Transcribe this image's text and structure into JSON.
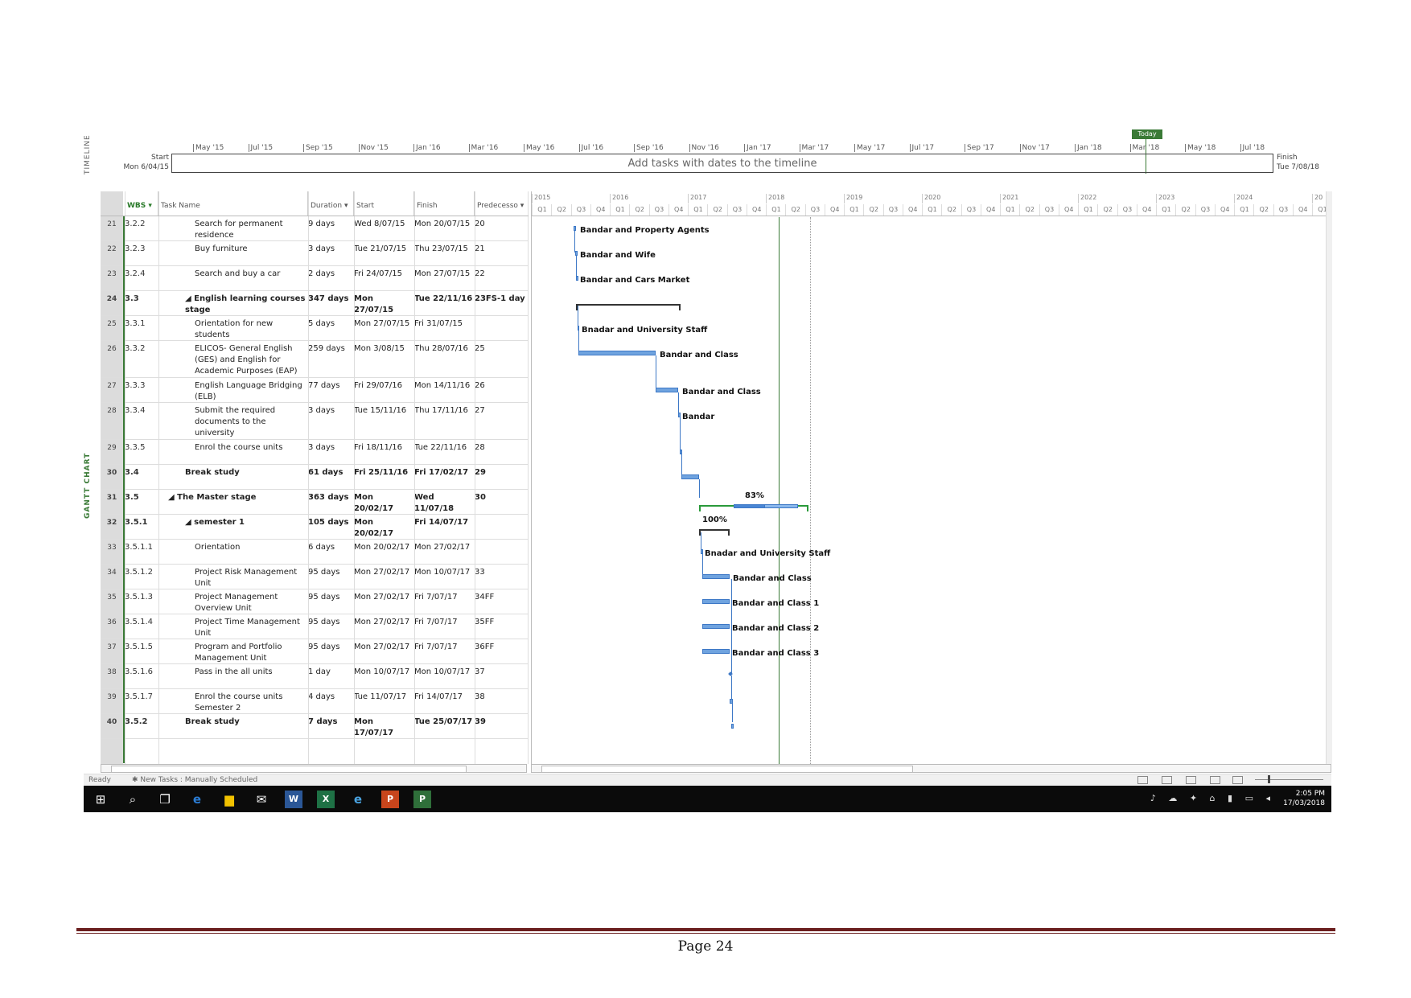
{
  "timeline": {
    "label": "TIMELINE",
    "months": [
      "May '15",
      "Jul '15",
      "Sep '15",
      "Nov '15",
      "Jan '16",
      "Mar '16",
      "May '16",
      "Jul '16",
      "Sep '16",
      "Nov '16",
      "Jan '17",
      "Mar '17",
      "May '17",
      "Jul '17",
      "Sep '17",
      "Nov '17",
      "Jan '18",
      "Mar '18",
      "May '18",
      "Jul '18"
    ],
    "start_label": "Start",
    "start_date": "Mon 6/04/15",
    "finish_label": "Finish",
    "finish_date": "Tue 7/08/18",
    "placeholder": "Add tasks with dates to the timeline",
    "today": "Today"
  },
  "gantt_label": "GANTT CHART",
  "columns": {
    "wbs": "WBS ▾",
    "task_name": "Task Name",
    "duration": "Duration ▾",
    "start": "Start",
    "finish": "Finish",
    "predecessors": "Predecesso ▾"
  },
  "years": [
    "2015",
    "2016",
    "2017",
    "2018",
    "2019",
    "2020",
    "2021",
    "2022",
    "2023",
    "2024",
    "20"
  ],
  "quarters": [
    "Q1",
    "Q2",
    "Q3",
    "Q4"
  ],
  "tasks": [
    {
      "id": "21",
      "wbs": "3.2.2",
      "name": "Search for permanent residence",
      "duration": "9 days",
      "start": "Wed 8/07/15",
      "finish": "Mon 20/07/15",
      "pred": "20",
      "bold": false,
      "indent": 3,
      "lines": 2
    },
    {
      "id": "22",
      "wbs": "3.2.3",
      "name": "Buy furniture",
      "duration": "3 days",
      "start": "Tue 21/07/15",
      "finish": "Thu 23/07/15",
      "pred": "21",
      "bold": false,
      "indent": 3,
      "lines": 2
    },
    {
      "id": "23",
      "wbs": "3.2.4",
      "name": "Search and buy a car",
      "duration": "2 days",
      "start": "Fri 24/07/15",
      "finish": "Mon 27/07/15",
      "pred": "22",
      "bold": false,
      "indent": 3,
      "lines": 2
    },
    {
      "id": "24",
      "wbs": "3.3",
      "name": "◢ English learning courses stage",
      "duration": "347 days",
      "start": "Mon 27/07/15",
      "finish": "Tue 22/11/16",
      "pred": "23FS-1 day",
      "bold": true,
      "indent": 2,
      "lines": 2
    },
    {
      "id": "25",
      "wbs": "3.3.1",
      "name": "Orientation for new students",
      "duration": "5 days",
      "start": "Mon 27/07/15",
      "finish": "Fri 31/07/15",
      "pred": "",
      "bold": false,
      "indent": 3,
      "lines": 2
    },
    {
      "id": "26",
      "wbs": "3.3.2",
      "name": "ELICOS- General English (GES) and English for Academic Purposes (EAP)",
      "duration": "259 days",
      "start": "Mon 3/08/15",
      "finish": "Thu 28/07/16",
      "pred": "25",
      "bold": false,
      "indent": 3,
      "lines": 3
    },
    {
      "id": "27",
      "wbs": "3.3.3",
      "name": "English Language Bridging (ELB)",
      "duration": "77 days",
      "start": "Fri 29/07/16",
      "finish": "Mon 14/11/16",
      "pred": "26",
      "bold": false,
      "indent": 3,
      "lines": 2
    },
    {
      "id": "28",
      "wbs": "3.3.4",
      "name": "Submit the required documents to the university",
      "duration": "3 days",
      "start": "Tue 15/11/16",
      "finish": "Thu 17/11/16",
      "pred": "27",
      "bold": false,
      "indent": 3,
      "lines": 3
    },
    {
      "id": "29",
      "wbs": "3.3.5",
      "name": "Enrol the course units",
      "duration": "3 days",
      "start": "Fri 18/11/16",
      "finish": "Tue 22/11/16",
      "pred": "28",
      "bold": false,
      "indent": 3,
      "lines": 2
    },
    {
      "id": "30",
      "wbs": "3.4",
      "name": "Break study",
      "duration": "61 days",
      "start": "Fri 25/11/16",
      "finish": "Fri 17/02/17",
      "pred": "29",
      "bold": true,
      "indent": 2,
      "lines": 2
    },
    {
      "id": "31",
      "wbs": "3.5",
      "name": "◢ The Master stage",
      "duration": "363 days",
      "start": "Mon 20/02/17",
      "finish": "Wed 11/07/18",
      "pred": "30",
      "bold": true,
      "indent": 1,
      "lines": 2
    },
    {
      "id": "32",
      "wbs": "3.5.1",
      "name": "◢ semester 1",
      "duration": "105 days",
      "start": "Mon 20/02/17",
      "finish": "Fri 14/07/17",
      "pred": "",
      "bold": true,
      "indent": 2,
      "lines": 2
    },
    {
      "id": "33",
      "wbs": "3.5.1.1",
      "name": "Orientation",
      "duration": "6 days",
      "start": "Mon 20/02/17",
      "finish": "Mon 27/02/17",
      "pred": "",
      "bold": false,
      "indent": 3,
      "lines": 2
    },
    {
      "id": "34",
      "wbs": "3.5.1.2",
      "name": "Project Risk Management Unit",
      "duration": "95 days",
      "start": "Mon 27/02/17",
      "finish": "Mon 10/07/17",
      "pred": "33",
      "bold": false,
      "indent": 3,
      "lines": 2
    },
    {
      "id": "35",
      "wbs": "3.5.1.3",
      "name": "Project Management Overview Unit",
      "duration": "95 days",
      "start": "Mon 27/02/17",
      "finish": "Fri 7/07/17",
      "pred": "34FF",
      "bold": false,
      "indent": 3,
      "lines": 2
    },
    {
      "id": "36",
      "wbs": "3.5.1.4",
      "name": "Project Time Management Unit",
      "duration": "95 days",
      "start": "Mon 27/02/17",
      "finish": "Fri 7/07/17",
      "pred": "35FF",
      "bold": false,
      "indent": 3,
      "lines": 2
    },
    {
      "id": "37",
      "wbs": "3.5.1.5",
      "name": "Program and Portfolio Management Unit",
      "duration": "95 days",
      "start": "Mon 27/02/17",
      "finish": "Fri 7/07/17",
      "pred": "36FF",
      "bold": false,
      "indent": 3,
      "lines": 2
    },
    {
      "id": "38",
      "wbs": "3.5.1.6",
      "name": "Pass in the all units",
      "duration": "1 day",
      "start": "Mon 10/07/17",
      "finish": "Mon 10/07/17",
      "pred": "37",
      "bold": false,
      "indent": 3,
      "lines": 2
    },
    {
      "id": "39",
      "wbs": "3.5.1.7",
      "name": "Enrol the course units Semester 2",
      "duration": "4 days",
      "start": "Tue 11/07/17",
      "finish": "Fri 14/07/17",
      "pred": "38",
      "bold": false,
      "indent": 3,
      "lines": 2
    },
    {
      "id": "40",
      "wbs": "3.5.2",
      "name": "Break study",
      "duration": "7 days",
      "start": "Mon 17/07/17",
      "finish": "Tue 25/07/17",
      "pred": "39",
      "bold": true,
      "indent": 2,
      "lines": 1
    }
  ],
  "chart_labels": {
    "r21": "Bandar and Property Agents",
    "r22": "Bandar and Wife",
    "r23": "Bandar and Cars Market",
    "r25": "Bnadar and University Staff",
    "r26": "Bandar and Class",
    "r27": "Bandar and Class",
    "r28": "Bandar",
    "r31_pct": "83%",
    "r32_pct": "100%",
    "r33": "Bnadar and University Staff",
    "r34": "Bandar and Class",
    "r35": "Bandar and Class 1",
    "r36": "Bandar and Class 2",
    "r37": "Bandar and Class 3"
  },
  "status": {
    "ready": "Ready",
    "new_tasks": "✱ New Tasks : Manually Scheduled"
  },
  "taskbar": {
    "time": "2:05 PM",
    "date": "17/03/2018",
    "icons": [
      "windows-start",
      "search",
      "task-view",
      "edge",
      "file-explorer",
      "mail",
      "word",
      "excel",
      "internet-explorer",
      "powerpoint",
      "project"
    ]
  },
  "footer": {
    "page": "Page 24"
  }
}
